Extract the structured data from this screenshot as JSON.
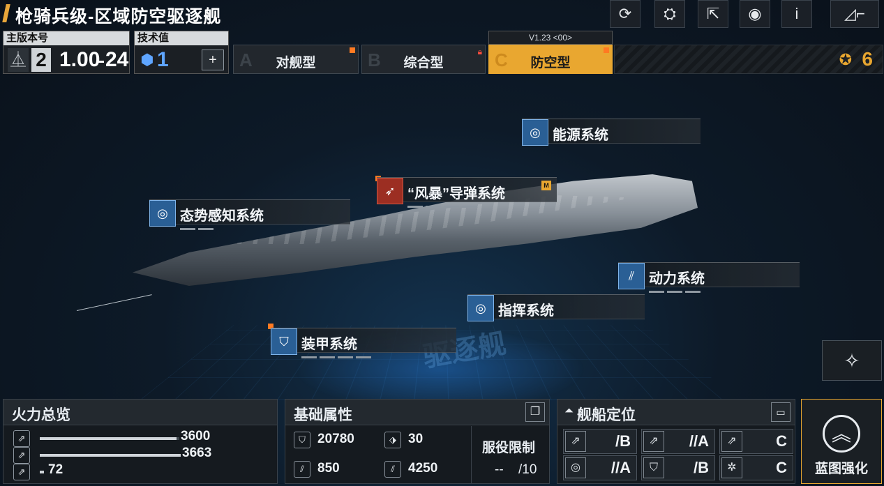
{
  "header": {
    "title": "枪骑兵级-区域防空驱逐舰",
    "buttons": [
      "refresh-icon",
      "upgrade-icon",
      "share-icon",
      "view-icon",
      "info-icon",
      "back-icon"
    ]
  },
  "version": {
    "label": "主版本号",
    "major": "2",
    "value": "1.00",
    "sub": "24"
  },
  "tech": {
    "label": "技术值",
    "value": "1",
    "button": "+"
  },
  "tabs": [
    {
      "letter": "A",
      "label": "对舰型"
    },
    {
      "letter": "B",
      "label": "综合型"
    },
    {
      "letter": "C",
      "label": "防空型",
      "version": "V1.23 <00>"
    }
  ],
  "points": "6",
  "callouts": {
    "energy": "能源系统",
    "storm": "“风暴”导弹系统",
    "storm_badge": "M",
    "awareness": "态势感知系统",
    "power": "动力系统",
    "command": "指挥系统",
    "armor": "装甲系统"
  },
  "floor_text": "驱逐舰",
  "firepower": {
    "title": "火力总览",
    "rows": [
      {
        "value": "3600",
        "fraction": 0.98
      },
      {
        "value": "3663",
        "fraction": 1.0
      },
      {
        "value": "72",
        "fraction": 0.03
      }
    ]
  },
  "attributes": {
    "title": "基础属性",
    "hp": "20780",
    "defense": "30",
    "speed": "850",
    "range": "4250",
    "service_label": "服役限制",
    "service_current": "--",
    "service_max": "/10"
  },
  "positioning": {
    "title": "舰船定位",
    "cells": [
      {
        "icon": "⇗",
        "grade": "/B"
      },
      {
        "icon": "⇗",
        "grade": "//A"
      },
      {
        "icon": "⇗",
        "grade": "C"
      },
      {
        "icon": "◎",
        "grade": "//A"
      },
      {
        "icon": "⛉",
        "grade": "/B"
      },
      {
        "icon": "✲",
        "grade": "C"
      }
    ]
  },
  "blueprint": {
    "label": "蓝图强化"
  }
}
